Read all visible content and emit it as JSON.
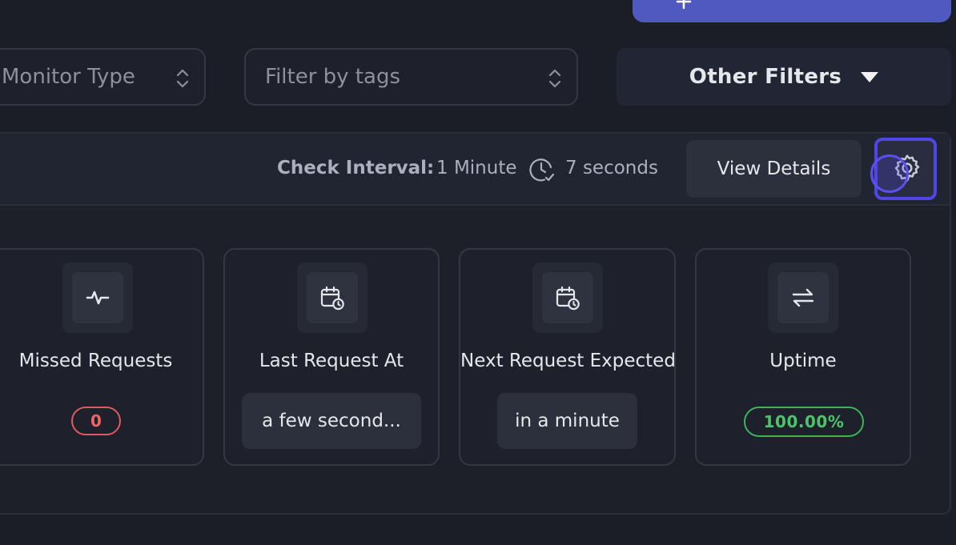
{
  "top_button": {
    "icon": "add-icon"
  },
  "filters": {
    "monitor_type_placeholder": "Monitor Type",
    "tags_placeholder": "Filter by tags",
    "other_filters_label": "Other Filters"
  },
  "monitor_card": {
    "check_interval_label": "Check Interval:",
    "check_interval_value": "1 Minute",
    "next_check_in": "7 seconds",
    "view_details_label": "View Details"
  },
  "stats": [
    {
      "label": "Missed Requests",
      "value": "0",
      "icon": "activity-icon"
    },
    {
      "label": "Last Request At",
      "value": "a few second...",
      "icon": "calendar-clock-icon"
    },
    {
      "label": "Next Request Expected",
      "value": "in a minute",
      "icon": "calendar-clock-icon"
    },
    {
      "label": "Uptime",
      "value": "100.00%",
      "icon": "arrows-exchange-icon"
    }
  ],
  "colors": {
    "background": "#1b1e27",
    "accent": "#4f46e5",
    "danger": "#f06565",
    "success": "#4cc46a"
  }
}
